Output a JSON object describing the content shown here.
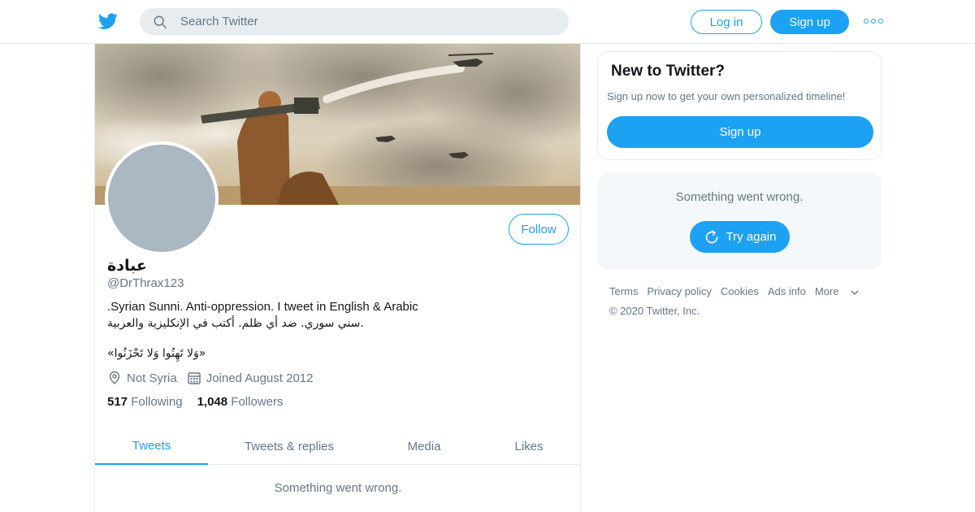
{
  "colors": {
    "accent": "#1da1f2",
    "muted": "#657786",
    "text": "#14171a",
    "avatar_placeholder": "#aab8c2"
  },
  "header": {
    "logo_icon": "twitter-bird-icon",
    "search_placeholder": "Search Twitter",
    "login_label": "Log in",
    "signup_label": "Sign up",
    "more_icon": "more-dots-icon"
  },
  "profile": {
    "name": "عبادة",
    "handle": "@DrThrax123",
    "follow_label": "Follow",
    "bio_en": ".Syrian Sunni. Anti-oppression. I tweet in English & Arabic",
    "bio_ar": "سني سوري. ضد أي ظلم. أكتب في الإنكليزية والعربية.",
    "quote": "«وَلا تَهِنُوا وَلا تَحْزَنُوا»",
    "location": "Not Syria",
    "joined": "Joined August 2012",
    "following_count": "517",
    "following_label": "Following",
    "followers_count": "1,048",
    "followers_label": "Followers"
  },
  "tabs": [
    {
      "label": "Tweets",
      "active": true
    },
    {
      "label": "Tweets & replies",
      "active": false
    },
    {
      "label": "Media",
      "active": false
    },
    {
      "label": "Likes",
      "active": false
    }
  ],
  "main_error": "Something went wrong.",
  "sidebar": {
    "new_title": "New to Twitter?",
    "new_text": "Sign up now to get your own personalized timeline!",
    "signup_label": "Sign up",
    "error_text": "Something went wrong.",
    "retry_label": "Try again"
  },
  "footer": {
    "links": [
      "Terms",
      "Privacy policy",
      "Cookies",
      "Ads info",
      "More"
    ],
    "copyright": "© 2020 Twitter, Inc."
  }
}
